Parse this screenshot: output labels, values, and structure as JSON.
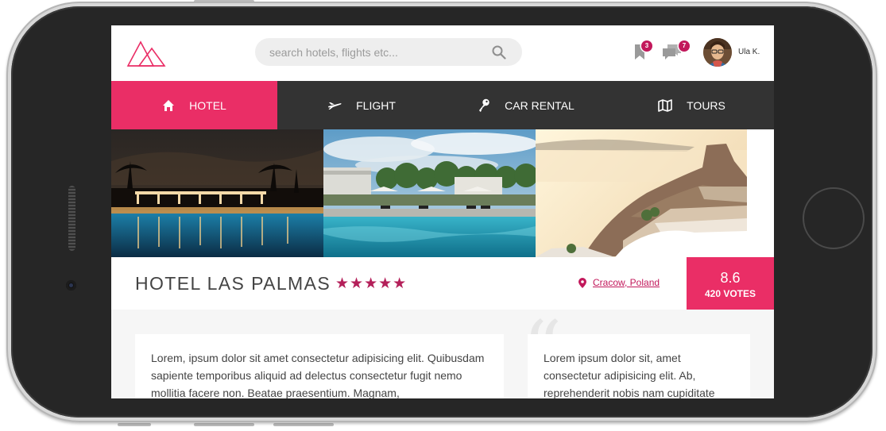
{
  "app": {
    "logo_name": "logo-icon"
  },
  "search": {
    "placeholder": "search hotels, flights etc..."
  },
  "header": {
    "bookmarks_badge": "3",
    "messages_badge": "7",
    "user_name": "Ula K."
  },
  "nav": {
    "items": [
      {
        "label": "HOTEL",
        "icon": "home-icon",
        "active": true
      },
      {
        "label": "FLIGHT",
        "icon": "airplane-icon",
        "active": false
      },
      {
        "label": "CAR RENTAL",
        "icon": "key-icon",
        "active": false
      },
      {
        "label": "TOURS",
        "icon": "map-icon",
        "active": false
      }
    ]
  },
  "hotel": {
    "name": "HOTEL LAS PALMAS",
    "stars": "★★★★★",
    "star_count": 5,
    "location": "Cracow, Poland",
    "rating": "8.6",
    "votes": "420 VOTES"
  },
  "content": {
    "description": "Lorem, ipsum dolor sit amet consectetur adipisicing elit. Quibusdam sapiente temporibus aliquid ad delectus consectetur fugit nemo mollitia facere non. Beatae praesentium. Magnam,",
    "quote_mark": "“",
    "review": "Lorem ipsum dolor sit, amet consectetur adipisicing elit. Ab, reprehenderit nobis nam cupiditate"
  },
  "colors": {
    "accent": "#ea2e66",
    "accent_dark": "#c2185b",
    "nav_bg": "#333333",
    "frame": "#262626"
  }
}
